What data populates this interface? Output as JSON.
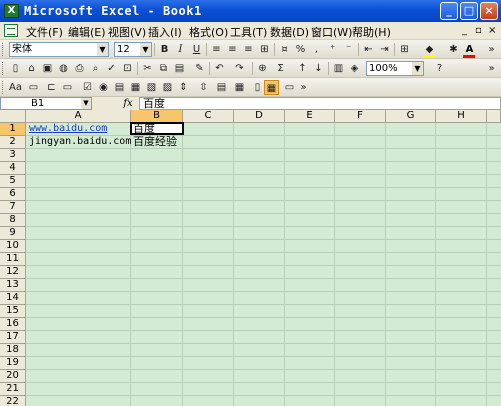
{
  "window": {
    "title": "Microsoft Excel - Book1",
    "app_icon": "X"
  },
  "window_buttons": {
    "minimize": "_",
    "maximize": "□",
    "close": "×"
  },
  "menu": [
    {
      "label": "文件(F)"
    },
    {
      "label": "编辑(E)"
    },
    {
      "label": "视图(V)"
    },
    {
      "label": "插入(I)"
    },
    {
      "label": "格式(O)"
    },
    {
      "label": "工具(T)"
    },
    {
      "label": "数据(D)"
    },
    {
      "label": "窗口(W)"
    },
    {
      "label": "帮助(H)"
    }
  ],
  "doc_controls": {
    "minimize": "_",
    "restore": "▫",
    "close": "×"
  },
  "format_toolbar": {
    "font_name": "宋体",
    "font_size": "12",
    "bold": "B",
    "italic": "I",
    "underline": "U",
    "percent": "%",
    "comma": ",",
    "font_color_label": "A",
    "colors": {
      "fill": "#ffff00",
      "font": "#ff0000"
    }
  },
  "standard_toolbar": {
    "zoom": "100%",
    "sum": "Σ"
  },
  "formula_bar": {
    "name_box": "B1",
    "fx": "fx",
    "value": "百度"
  },
  "columns": [
    "A",
    "B",
    "C",
    "D",
    "E",
    "F",
    "G",
    "H"
  ],
  "rows": [
    "1",
    "2",
    "3",
    "4",
    "5",
    "6",
    "7",
    "8",
    "9",
    "10",
    "11",
    "12",
    "13",
    "14",
    "15",
    "16",
    "17",
    "18",
    "19",
    "20",
    "21",
    "22"
  ],
  "cells": {
    "A1": "www.baidu.com",
    "B1": "百度",
    "A2": "jingyan.baidu.com",
    "B2": "百度经验"
  },
  "active_cell": {
    "column": "B",
    "row": "1"
  },
  "colors": {
    "grid_background": "#d2ebd2",
    "active_header": "#f7c56a",
    "titlebar": "#0a4fd6",
    "hyperlink": "#1a3cc8"
  }
}
